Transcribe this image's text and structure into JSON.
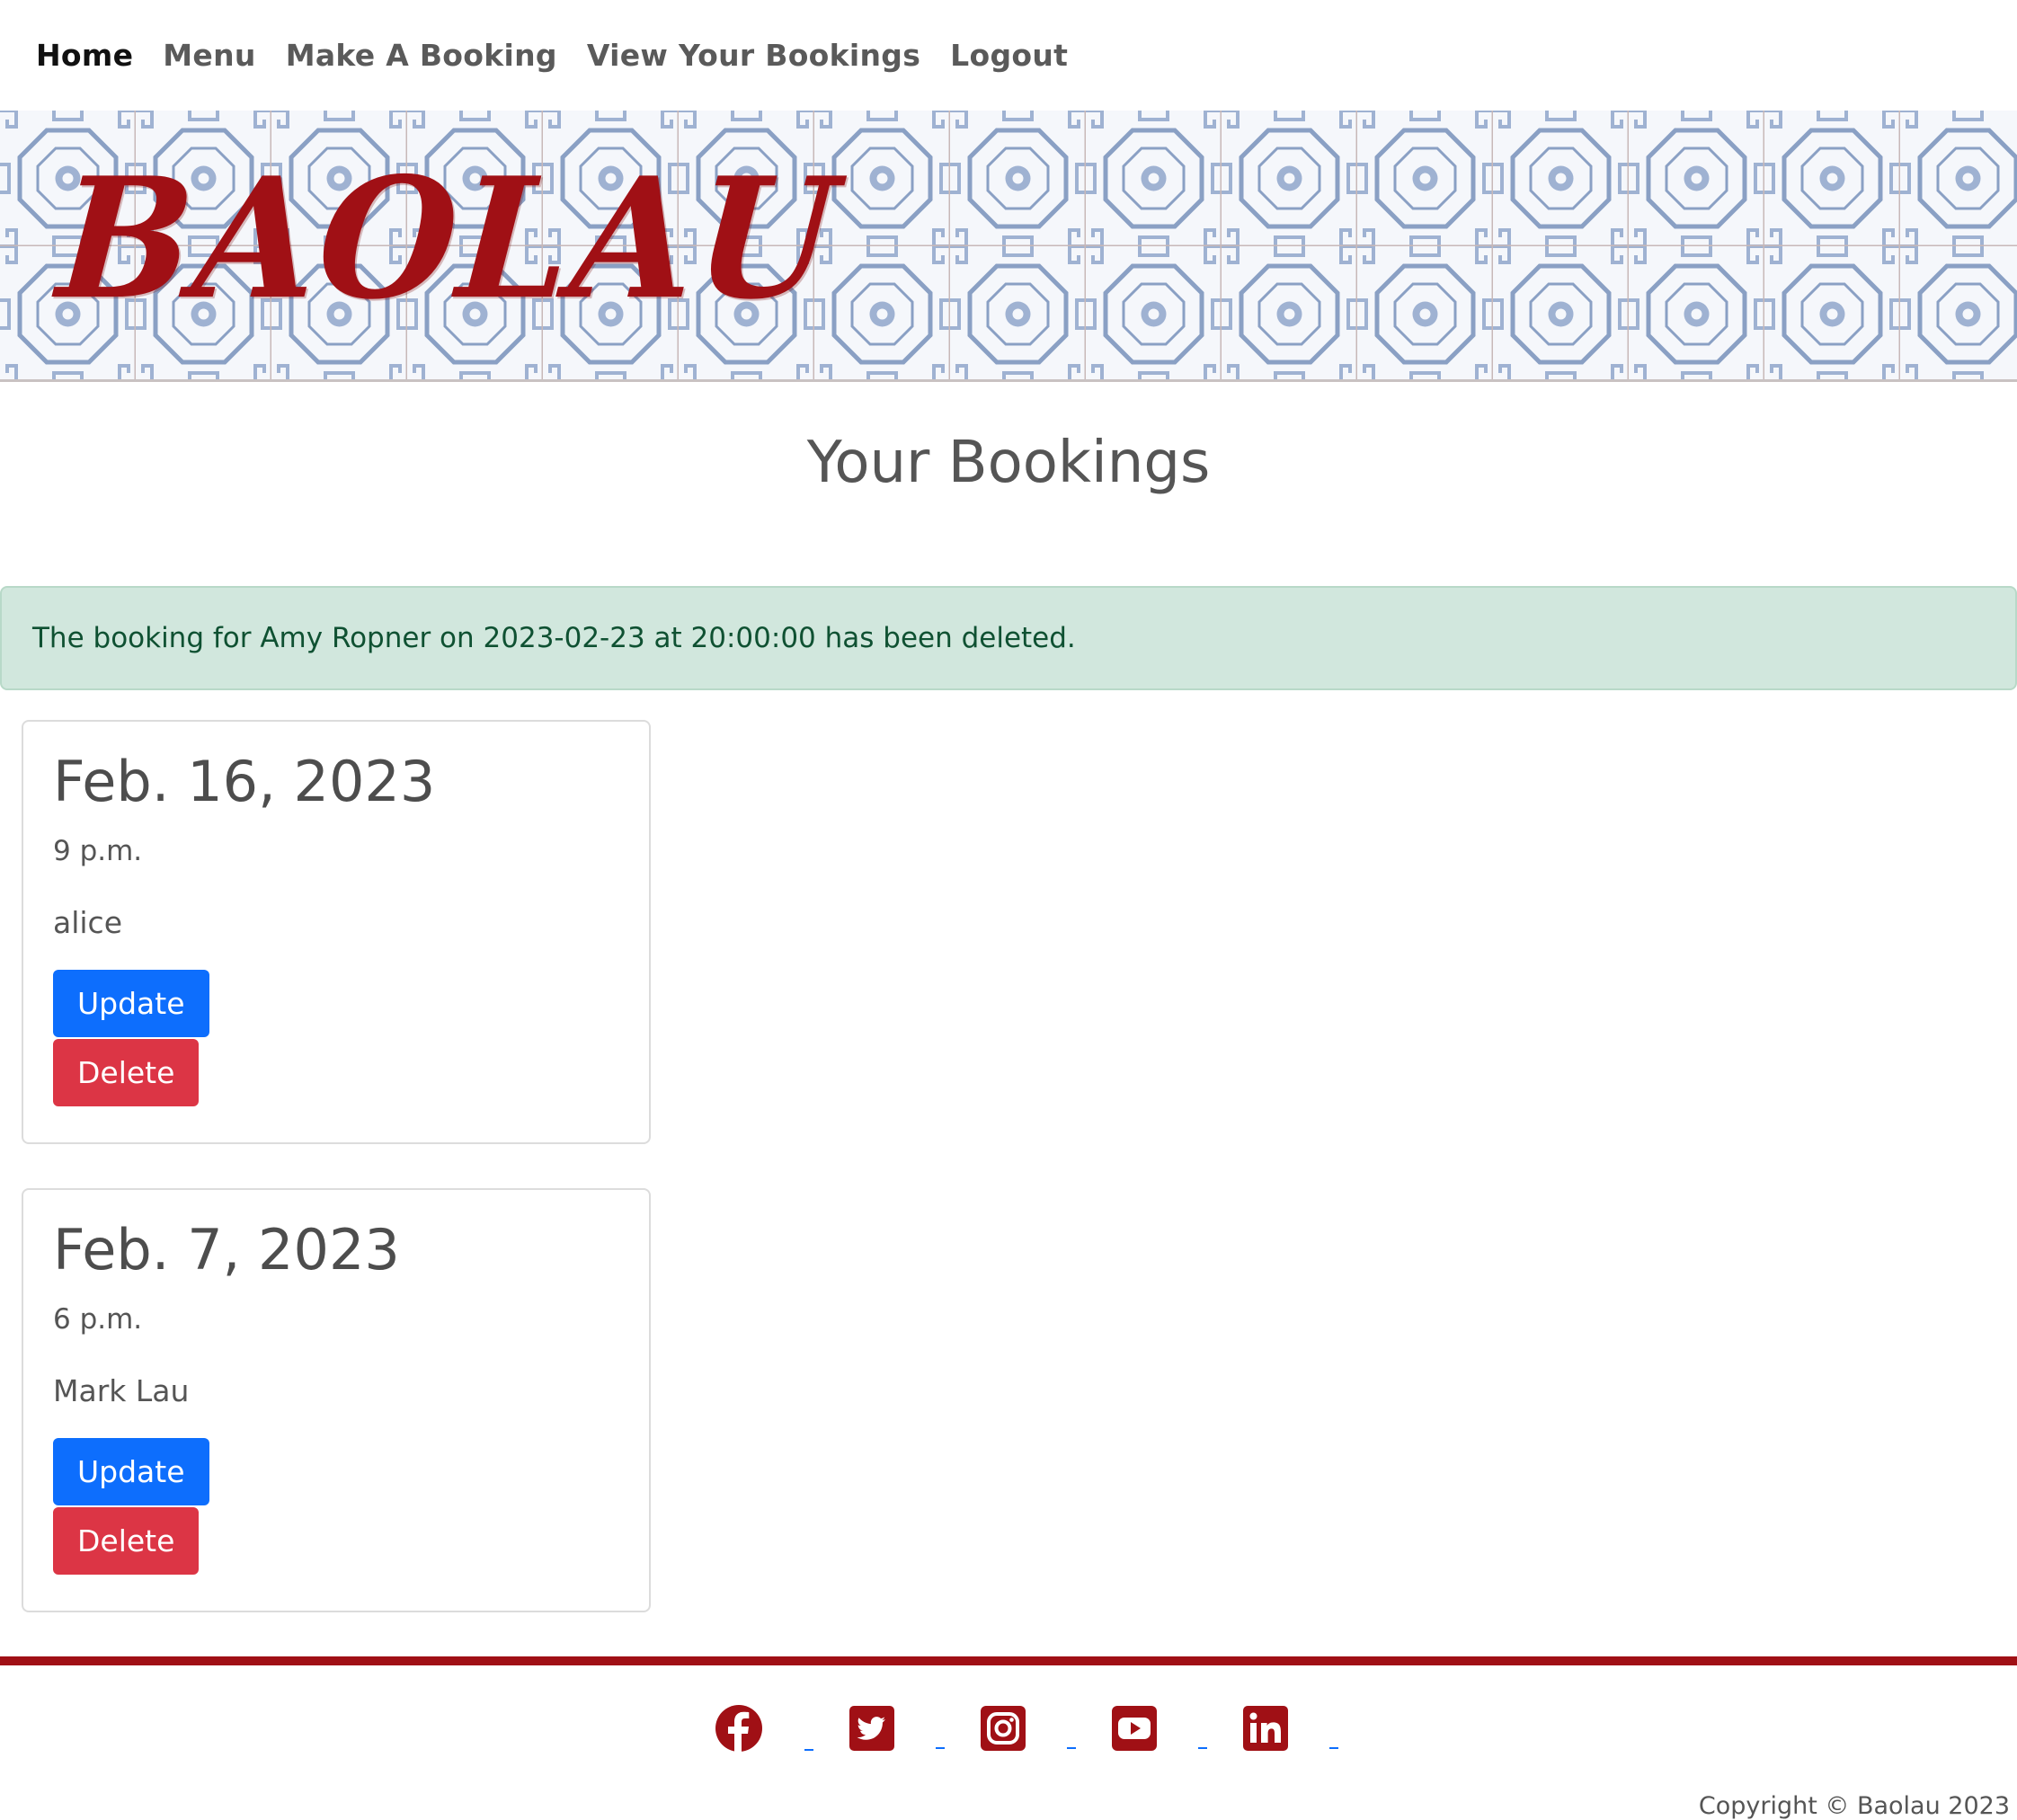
{
  "nav": {
    "items": [
      {
        "label": "Home",
        "active": true
      },
      {
        "label": "Menu",
        "active": false
      },
      {
        "label": "Make A Booking",
        "active": false
      },
      {
        "label": "View Your Bookings",
        "active": false
      },
      {
        "label": "Logout",
        "active": false
      }
    ]
  },
  "hero": {
    "brand": "BAOLAU"
  },
  "page": {
    "title": "Your Bookings"
  },
  "alert": {
    "message": "The booking for Amy Ropner on 2023-02-23 at 20:00:00 has been deleted."
  },
  "bookings": [
    {
      "date": "Feb. 16, 2023",
      "time": "9 p.m.",
      "name": "alice",
      "update_label": "Update",
      "delete_label": "Delete"
    },
    {
      "date": "Feb. 7, 2023",
      "time": "6 p.m.",
      "name": "Mark Lau",
      "update_label": "Update",
      "delete_label": "Delete"
    }
  ],
  "footer": {
    "socials": [
      "facebook-icon",
      "twitter-icon",
      "instagram-icon",
      "youtube-icon",
      "linkedin-icon"
    ],
    "copyright": "Copyright © Baolau 2023"
  },
  "colors": {
    "brand_red": "#a01015",
    "update_blue": "#0d6efd",
    "delete_red": "#dc3545",
    "alert_bg": "#d1e7dd",
    "alert_text": "#0f5132"
  }
}
